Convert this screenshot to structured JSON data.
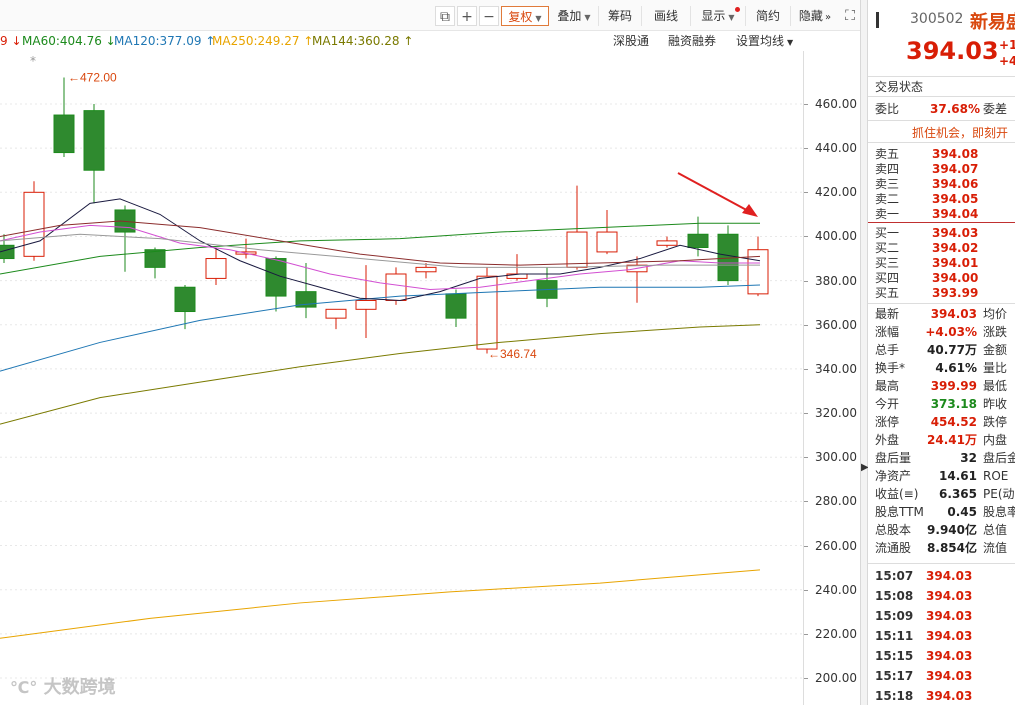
{
  "toolbar": {
    "buttons": [
      {
        "label": "复权"
      },
      {
        "label": "叠加"
      },
      {
        "label": "筹码"
      },
      {
        "label": "画线"
      },
      {
        "label": "显示"
      },
      {
        "label": "简约"
      },
      {
        "label": "隐藏"
      }
    ]
  },
  "ma_bar": {
    "items": [
      {
        "text": "9 ↓",
        "color": "#d81e06"
      },
      {
        "text": "MA60:404.76 ↓",
        "color": "#1c8a1c"
      },
      {
        "text": "MA120:377.09 ↑",
        "color": "#1f77b4"
      },
      {
        "text": "MA250:249.27 ↑",
        "color": "#e8a400"
      },
      {
        "text": "MA144:360.28 ↑",
        "color": "#7a7a00"
      }
    ],
    "right": [
      "深股通",
      "融资融券",
      "设置均线"
    ]
  },
  "chart_data": {
    "type": "candlestick",
    "ylim": [
      195,
      475
    ],
    "y_ticks": [
      "460.00",
      "440.00",
      "420.00",
      "400.00",
      "380.00",
      "360.00",
      "340.00",
      "320.00",
      "300.00",
      "280.00",
      "260.00",
      "240.00",
      "220.00",
      "200.00"
    ],
    "annotations": [
      {
        "text": "472.00"
      },
      {
        "text": "346.74"
      }
    ],
    "candles": [
      {
        "o": 396,
        "h": 401,
        "l": 388,
        "c": 390,
        "dir": "down"
      },
      {
        "o": 391,
        "h": 425,
        "l": 389,
        "c": 420,
        "dir": "up"
      },
      {
        "o": 455,
        "h": 472,
        "l": 436,
        "c": 438,
        "dir": "down"
      },
      {
        "o": 457,
        "h": 460,
        "l": 415,
        "c": 430,
        "dir": "down"
      },
      {
        "o": 412,
        "h": 414,
        "l": 384,
        "c": 402,
        "dir": "down"
      },
      {
        "o": 394,
        "h": 395,
        "l": 381,
        "c": 386,
        "dir": "down"
      },
      {
        "o": 377,
        "h": 378,
        "l": 358,
        "c": 366,
        "dir": "down"
      },
      {
        "o": 381,
        "h": 395,
        "l": 378,
        "c": 390,
        "dir": "up"
      },
      {
        "o": 393,
        "h": 399,
        "l": 390,
        "c": 392,
        "dir": "up"
      },
      {
        "o": 390,
        "h": 391,
        "l": 366,
        "c": 373,
        "dir": "down"
      },
      {
        "o": 375,
        "h": 388,
        "l": 363,
        "c": 368,
        "dir": "down"
      },
      {
        "o": 363,
        "h": 367,
        "l": 358,
        "c": 367,
        "dir": "up"
      },
      {
        "o": 367,
        "h": 387,
        "l": 354,
        "c": 371,
        "dir": "up"
      },
      {
        "o": 371,
        "h": 386,
        "l": 369,
        "c": 383,
        "dir": "up"
      },
      {
        "o": 384,
        "h": 388,
        "l": 381,
        "c": 386,
        "dir": "up"
      },
      {
        "o": 374,
        "h": 376,
        "l": 359,
        "c": 363,
        "dir": "down"
      },
      {
        "o": 349,
        "h": 386,
        "l": 347,
        "c": 382,
        "dir": "up"
      },
      {
        "o": 381,
        "h": 392,
        "l": 380,
        "c": 383,
        "dir": "up"
      },
      {
        "o": 380,
        "h": 386,
        "l": 368,
        "c": 372,
        "dir": "down"
      },
      {
        "o": 386,
        "h": 423,
        "l": 385,
        "c": 402,
        "dir": "up"
      },
      {
        "o": 393,
        "h": 412,
        "l": 392,
        "c": 402,
        "dir": "up"
      },
      {
        "o": 384,
        "h": 391,
        "l": 370,
        "c": 387,
        "dir": "up"
      },
      {
        "o": 396,
        "h": 400,
        "l": 395,
        "c": 398,
        "dir": "up"
      },
      {
        "o": 401,
        "h": 409,
        "l": 391,
        "c": 395,
        "dir": "down"
      },
      {
        "o": 401,
        "h": 405,
        "l": 378,
        "c": 380,
        "dir": "down"
      },
      {
        "o": 374,
        "h": 400,
        "l": 373,
        "c": 394,
        "dir": "up"
      }
    ]
  },
  "quote": {
    "code": "300502",
    "name": "新易盛",
    "price": "394.03",
    "change": "+1",
    "change_pct": "+4"
  },
  "order_book": {
    "status_label": "交易状态",
    "ratio_label": "委比",
    "ratio_value": "37.68%",
    "diff_label": "委差",
    "promo": "抓住机会，即刻开",
    "sells": [
      {
        "label": "卖五",
        "price": "394.08"
      },
      {
        "label": "卖四",
        "price": "394.07"
      },
      {
        "label": "卖三",
        "price": "394.06"
      },
      {
        "label": "卖二",
        "price": "394.05"
      },
      {
        "label": "卖一",
        "price": "394.04"
      }
    ],
    "buys": [
      {
        "label": "买一",
        "price": "394.03"
      },
      {
        "label": "买二",
        "price": "394.02"
      },
      {
        "label": "买三",
        "price": "394.01"
      },
      {
        "label": "买四",
        "price": "394.00"
      },
      {
        "label": "买五",
        "price": "393.99"
      }
    ]
  },
  "stats": [
    {
      "label": "最新",
      "value": "394.03",
      "color": "red",
      "label2": "均价"
    },
    {
      "label": "涨幅",
      "value": "+4.03%",
      "color": "red",
      "label2": "涨跌"
    },
    {
      "label": "总手",
      "value": "40.77万",
      "color": "dark",
      "label2": "金额"
    },
    {
      "label": "换手*",
      "value": "4.61%",
      "color": "dark",
      "label2": "量比"
    },
    {
      "label": "最高",
      "value": "399.99",
      "color": "red",
      "label2": "最低"
    },
    {
      "label": "今开",
      "value": "373.18",
      "color": "green",
      "label2": "昨收"
    },
    {
      "label": "涨停",
      "value": "454.52",
      "color": "red",
      "label2": "跌停"
    },
    {
      "label": "外盘",
      "value": "24.41万",
      "color": "red",
      "label2": "内盘"
    },
    {
      "label": "盘后量",
      "value": "32",
      "color": "dark",
      "label2": "盘后金"
    },
    {
      "label": "净资产",
      "value": "14.61",
      "color": "dark",
      "label2": "ROE"
    },
    {
      "label": "收益(≡)",
      "value": "6.365",
      "color": "dark",
      "label2": "PE(动"
    },
    {
      "label": "股息TTM",
      "value": "0.45",
      "color": "dark",
      "label2": "股息率"
    },
    {
      "label": "总股本",
      "value": "9.940亿",
      "color": "dark",
      "label2": "总值"
    },
    {
      "label": "流通股",
      "value": "8.854亿",
      "color": "dark",
      "label2": "流值"
    }
  ],
  "ticks": [
    {
      "time": "15:07",
      "price": "394.03"
    },
    {
      "time": "15:08",
      "price": "394.03"
    },
    {
      "time": "15:09",
      "price": "394.03"
    },
    {
      "time": "15:11",
      "price": "394.03"
    },
    {
      "time": "15:15",
      "price": "394.03"
    },
    {
      "time": "15:17",
      "price": "394.03"
    },
    {
      "time": "15:18",
      "price": "394.03"
    }
  ],
  "watermark": "大数跨境"
}
